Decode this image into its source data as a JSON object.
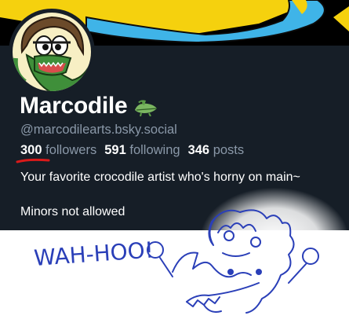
{
  "profile": {
    "display_name": "Marcodile",
    "name_emoji": "crocodile-emoji",
    "handle": "@marcodilearts.bsky.social",
    "stats": {
      "followers_count": "300",
      "followers_label": "followers",
      "following_count": "591",
      "following_label": "following",
      "posts_count": "346",
      "posts_label": "posts"
    },
    "bio_line_1": "Your favorite crocodile artist who's horny on main~",
    "bio_line_2": "Minors not allowed"
  },
  "doodle": {
    "caption": "WAH-HOO!"
  },
  "colors": {
    "background": "#161e27",
    "banner_yellow": "#f5d10e",
    "banner_blue": "#3fb4e8",
    "muted_text": "#8a98a8",
    "ink_blue": "#2a3fb8",
    "underline_red": "#d91a1a",
    "croc_green": "#3f8f3a"
  }
}
